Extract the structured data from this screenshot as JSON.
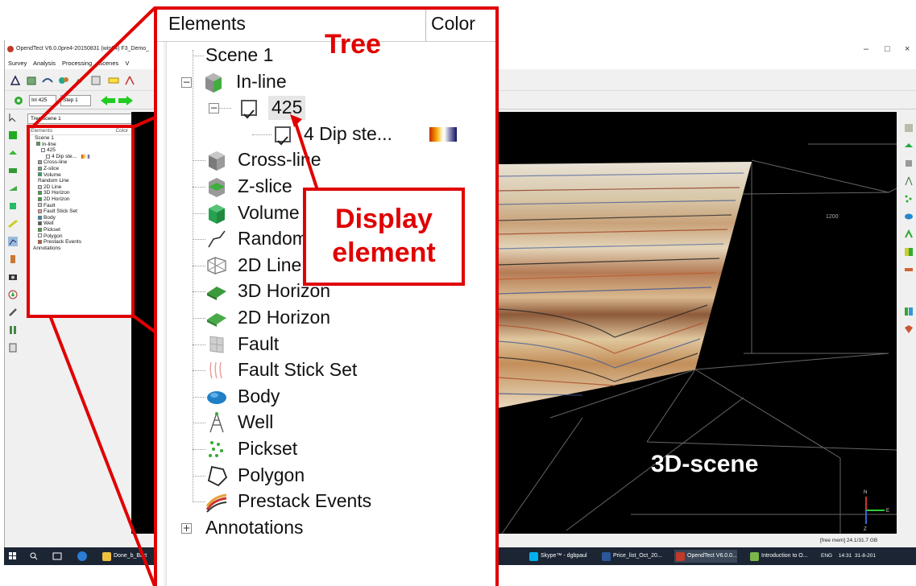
{
  "window": {
    "title": "OpendTect V6.0.0pre4-20150831 (win64) F3_Demo_",
    "controls": [
      "–",
      "□",
      "×"
    ]
  },
  "menu": [
    "Survey",
    "Analysis",
    "Processing",
    "Scenes",
    "V"
  ],
  "toolbar2": {
    "inline_label": "Inl 425",
    "step_label": "Step 1"
  },
  "small_tree": {
    "title": "Tree scene 1",
    "header_elements": "Elements",
    "header_color": "Color",
    "items": [
      "Scene 1",
      "In-line",
      "425",
      "4 Dip ste...",
      "Cross-line",
      "Z-slice",
      "Volume",
      "Random Line",
      "2D Line",
      "3D Horizon",
      "2D Horizon",
      "Fault",
      "Fault Stick Set",
      "Body",
      "Well",
      "Pickset",
      "Polygon",
      "Prestack Events",
      "Annotations"
    ]
  },
  "zoom_tree": {
    "header_elements": "Elements",
    "header_color": "Color",
    "items": [
      {
        "label": "Scene 1",
        "icon": "none"
      },
      {
        "label": "In-line",
        "icon": "inline-cube-icon"
      },
      {
        "label": "425",
        "icon": "checkbox"
      },
      {
        "label": "4 Dip ste...",
        "icon": "checkbox"
      },
      {
        "label": "Cross-line",
        "icon": "crossline-cube-icon"
      },
      {
        "label": "Z-slice",
        "icon": "zslice-cube-icon"
      },
      {
        "label": "Volume",
        "icon": "volume-cube-icon"
      },
      {
        "label": "Random Line",
        "icon": "random-line-icon"
      },
      {
        "label": "2D Line",
        "icon": "2d-line-icon"
      },
      {
        "label": "3D Horizon",
        "icon": "3d-horizon-icon"
      },
      {
        "label": "2D Horizon",
        "icon": "2d-horizon-icon"
      },
      {
        "label": "Fault",
        "icon": "fault-icon"
      },
      {
        "label": "Fault Stick Set",
        "icon": "fault-stick-icon"
      },
      {
        "label": "Body",
        "icon": "body-icon"
      },
      {
        "label": "Well",
        "icon": "well-icon"
      },
      {
        "label": "Pickset",
        "icon": "pickset-icon"
      },
      {
        "label": "Polygon",
        "icon": "polygon-icon"
      },
      {
        "label": "Prestack Events",
        "icon": "prestack-icon"
      },
      {
        "label": "Annotations",
        "icon": "none"
      }
    ]
  },
  "annotations": {
    "tree": "Tree",
    "display_element_line1": "Display",
    "display_element_line2": "element",
    "scene": "3D-scene"
  },
  "scene": {
    "axis_tick": "1200",
    "status": "[free mem] 24.1/31.7 GB",
    "axis_labels": [
      "N",
      "E",
      "Z"
    ]
  },
  "taskbar": {
    "items": [
      "Done_b_Bart",
      "Skype™ - dgbpaul",
      "Price_list_Oct_20...",
      "OpendTect V6.0.0...",
      "Introduction to O..."
    ],
    "tray_lang": "ENG",
    "time": "14:31",
    "date": "31-8-201"
  },
  "colors": {
    "annotation_red": "#e00000",
    "scene_bg": "#000000",
    "taskbar_bg": "#1c2533"
  }
}
